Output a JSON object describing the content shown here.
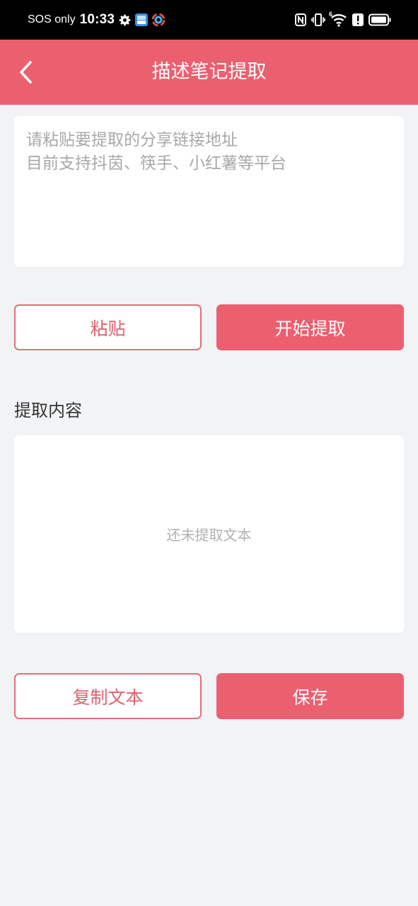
{
  "status_bar": {
    "carrier": "SOS only",
    "time": "10:33",
    "icons": [
      "gear-icon",
      "app-icon-blue",
      "app-icon-color",
      "nfc-icon",
      "vibrate-icon",
      "wifi-icon",
      "alert-icon",
      "battery-icon"
    ],
    "wifi_label": "6"
  },
  "header": {
    "title": "描述笔记提取",
    "back_icon": "chevron-left-icon",
    "background": "#ec5f6f"
  },
  "input": {
    "value": "",
    "placeholder": "请粘贴要提取的分享链接地址\n目前支持抖茵、筷手、小红薯等平台"
  },
  "actions_top": {
    "paste_label": "粘贴",
    "start_label": "开始提取"
  },
  "result": {
    "section_title": "提取内容",
    "empty_text": "还未提取文本"
  },
  "actions_bottom": {
    "copy_label": "复制文本",
    "save_label": "保存"
  },
  "colors": {
    "accent": "#ec5f6f",
    "page_bg": "#f2f3f5",
    "status_bar_bg": "#000000"
  }
}
